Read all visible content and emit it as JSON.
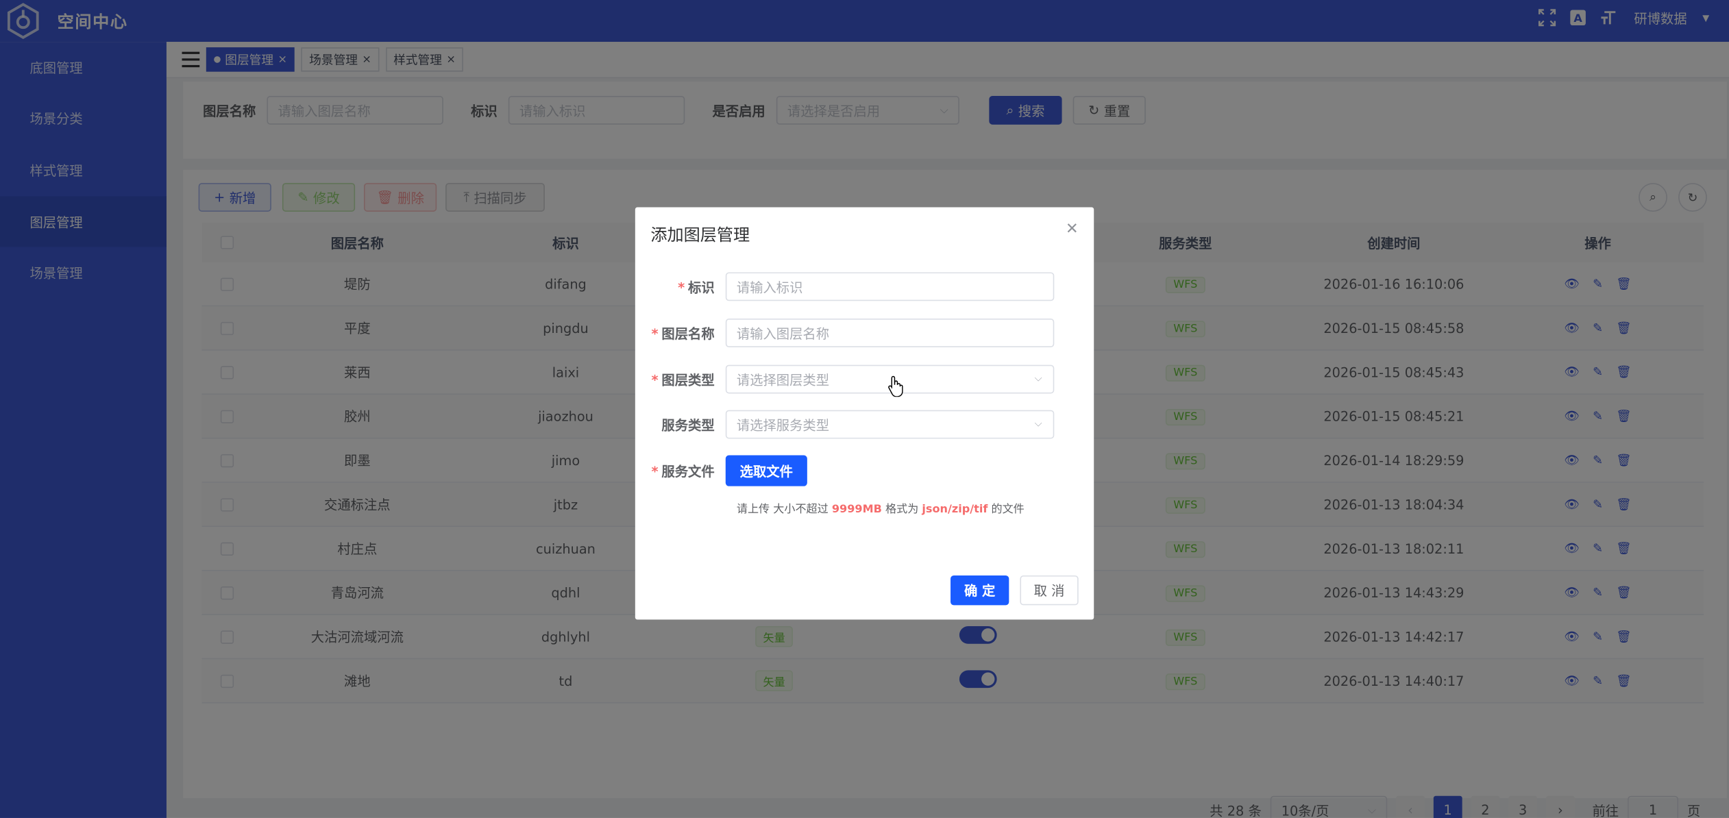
{
  "header": {
    "app_title": "空间中心",
    "user_name": "研博数据",
    "icons": [
      "fullscreen-icon",
      "translate-icon",
      "font-size-icon",
      "caret-down-icon"
    ]
  },
  "sidebar": {
    "items": [
      {
        "label": "底图管理",
        "active": false
      },
      {
        "label": "场景分类",
        "active": false
      },
      {
        "label": "样式管理",
        "active": false
      },
      {
        "label": "图层管理",
        "active": true
      },
      {
        "label": "场景管理",
        "active": false
      }
    ]
  },
  "tabs": [
    {
      "label": "图层管理",
      "active": true
    },
    {
      "label": "场景管理",
      "active": false
    },
    {
      "label": "样式管理",
      "active": false
    }
  ],
  "search": {
    "layer_name_label": "图层名称",
    "layer_name_placeholder": "请输入图层名称",
    "id_label": "标识",
    "id_placeholder": "请输入标识",
    "enabled_label": "是否启用",
    "enabled_placeholder": "请选择是否启用",
    "search_button": "搜索",
    "reset_button": "重置"
  },
  "toolbar": {
    "add": "新增",
    "edit": "修改",
    "delete": "删除",
    "sync": "扫描同步"
  },
  "table": {
    "columns": [
      "图层名称",
      "标识",
      "服务类型",
      "创建时间",
      "操作"
    ],
    "rows": [
      {
        "name": "堤防",
        "id": "difang",
        "type": "",
        "enabled": null,
        "service": "WFS",
        "created": "2026-01-16 16:10:06"
      },
      {
        "name": "平度",
        "id": "pingdu",
        "type": "",
        "enabled": null,
        "service": "WFS",
        "created": "2026-01-15 08:45:58"
      },
      {
        "name": "莱西",
        "id": "laixi",
        "type": "",
        "enabled": null,
        "service": "WFS",
        "created": "2026-01-15 08:45:43"
      },
      {
        "name": "胶州",
        "id": "jiaozhou",
        "type": "",
        "enabled": null,
        "service": "WFS",
        "created": "2026-01-15 08:45:21"
      },
      {
        "name": "即墨",
        "id": "jimo",
        "type": "",
        "enabled": null,
        "service": "WFS",
        "created": "2026-01-14 18:29:59"
      },
      {
        "name": "交通标注点",
        "id": "jtbz",
        "type": "",
        "enabled": null,
        "service": "WFS",
        "created": "2026-01-13 18:04:34"
      },
      {
        "name": "村庄点",
        "id": "cuizhuan",
        "type": "",
        "enabled": null,
        "service": "WFS",
        "created": "2026-01-13 18:02:11"
      },
      {
        "name": "青岛河流",
        "id": "qdhl",
        "type": "",
        "enabled": null,
        "service": "WFS",
        "created": "2026-01-13 14:43:29"
      },
      {
        "name": "大沽河流域河流",
        "id": "dghlyhl",
        "type": "矢量",
        "enabled": true,
        "service": "WFS",
        "created": "2026-01-13 14:42:17"
      },
      {
        "name": "滩地",
        "id": "td",
        "type": "矢量",
        "enabled": true,
        "service": "WFS",
        "created": "2026-01-13 14:40:17"
      }
    ]
  },
  "pagination": {
    "total_text": "共 28 条",
    "page_size": "10条/页",
    "pages": [
      "1",
      "2",
      "3"
    ],
    "current": "1",
    "goto_label": "前往",
    "goto_value": "1",
    "page_suffix": "页"
  },
  "dialog": {
    "title": "添加图层管理",
    "fields": {
      "id_label": "标识",
      "id_placeholder": "请输入标识",
      "name_label": "图层名称",
      "name_placeholder": "请输入图层名称",
      "type_label": "图层类型",
      "type_placeholder": "请选择图层类型",
      "service_label": "服务类型",
      "service_placeholder": "请选择服务类型",
      "file_label": "服务文件",
      "file_button": "选取文件"
    },
    "tip": {
      "prefix": "请上传 大小不超过 ",
      "size": "9999MB",
      "middle": " 格式为 ",
      "formats": "json/zip/tif",
      "suffix": " 的文件"
    },
    "ok": "确 定",
    "cancel": "取 消"
  },
  "colors": {
    "primary": "#3f5bd6",
    "dialog_button": "#1a5cff",
    "required": "#f56c6c",
    "tag_green": "#67c23a"
  }
}
